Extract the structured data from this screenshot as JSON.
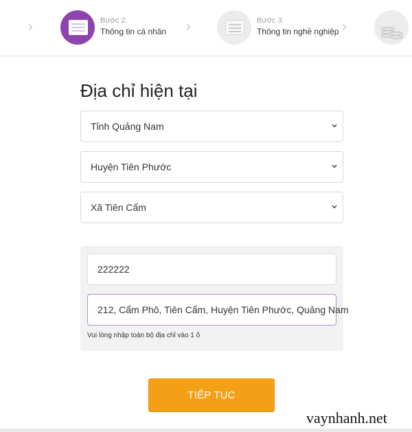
{
  "stepper": {
    "step2": {
      "number": "Bước 2.",
      "name": "Thông tin cá nhân",
      "icon": "document-icon",
      "state": "active"
    },
    "step3": {
      "number": "Bước 3.",
      "name": "Thông tin nghề nghiệp",
      "icon": "document-icon",
      "state": "inactive"
    },
    "step4": {
      "icon": "coins-icon",
      "state": "inactive"
    },
    "separator_icon": "chevron-right-icon"
  },
  "address": {
    "title": "Địa chỉ hiện tại",
    "province": "Tỉnh Quảng Nam",
    "district": "Huyện Tiên Phước",
    "ward": "Xã Tiên Cẩm",
    "postal_code": "222222",
    "full_address": "212, Cẩm Phô, Tiên Cẩm, Huyện Tiên Phước, Quảng Nam",
    "hint": "Vui lòng nhập toàn bộ địa chỉ vào 1 ô"
  },
  "continue_label": "TIẾP TỤC",
  "watermark": "vaynhanh.net",
  "colors": {
    "accent_purple": "#8e44ad",
    "button_orange": "#f4a017",
    "focus_border": "#b28fcc"
  }
}
